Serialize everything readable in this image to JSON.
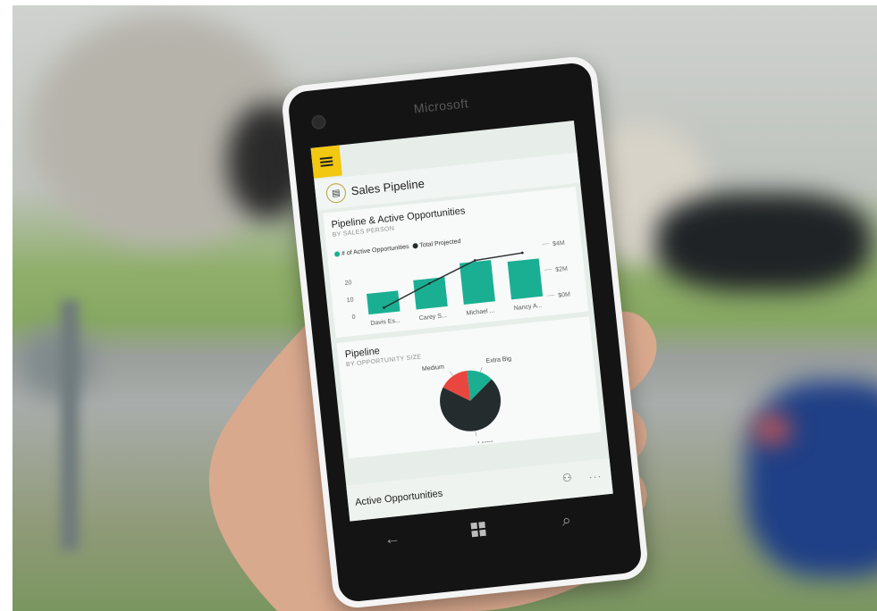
{
  "phone": {
    "brand": "Microsoft"
  },
  "app": {
    "report_title": "Sales Pipeline",
    "menu_icon": "hamburger-icon",
    "report_icon": "clipboard-icon"
  },
  "card1": {
    "title": "Pipeline & Active Opportunities",
    "subtitle": "BY SALES PERSON",
    "legend": [
      {
        "label": "# of Active Opportunities",
        "color": "#1aaf93"
      },
      {
        "label": "Total Projected",
        "color": "#252c2e"
      }
    ]
  },
  "card2": {
    "title": "Pipeline",
    "subtitle": "BY OPPORTUNITY SIZE"
  },
  "card3": {
    "title": "Active Opportunities"
  },
  "chart_data": [
    {
      "type": "bar",
      "title": "Pipeline & Active Opportunities",
      "subtitle": "BY SALES PERSON",
      "categories": [
        "Davis Es...",
        "Carey S...",
        "Michael ...",
        "Nancy A..."
      ],
      "series": [
        {
          "name": "# of Active Opportunities",
          "type": "bar",
          "axis": "left",
          "values": [
            12,
            17,
            24,
            22
          ],
          "color": "#1aaf93"
        },
        {
          "name": "Total Projected",
          "type": "line",
          "axis": "right",
          "values": [
            0.4,
            1.9,
            3.3,
            3.5
          ],
          "color": "#252c2e"
        }
      ],
      "left_ticks": [
        "0",
        "10",
        "20"
      ],
      "right_ticks": [
        "$0M",
        "$2M",
        "$4M"
      ],
      "ylim": [
        0,
        30
      ],
      "y2lim": [
        0,
        4
      ],
      "legend_position": "top-left"
    },
    {
      "type": "pie",
      "title": "Pipeline",
      "subtitle": "BY OPPORTUNITY SIZE",
      "slices": [
        {
          "label": "Extra Big",
          "value": 14,
          "color": "#1aaf93"
        },
        {
          "label": "Large",
          "value": 70,
          "color": "#252c2e"
        },
        {
          "label": "Medium",
          "value": 16,
          "color": "#e8463f"
        }
      ],
      "shown_labels": [
        "Extra Big",
        "Large",
        "Medium"
      ]
    }
  ],
  "nav": {
    "back_icon": "back-arrow-icon",
    "home_icon": "windows-logo-icon",
    "search_icon": "search-icon",
    "person_icon": "person-add-icon",
    "more_icon": "more-icon",
    "more_label": "..."
  },
  "colors": {
    "accent": "#f2c811",
    "bar": "#1aaf93",
    "dark": "#252c2e",
    "red": "#e8463f"
  }
}
